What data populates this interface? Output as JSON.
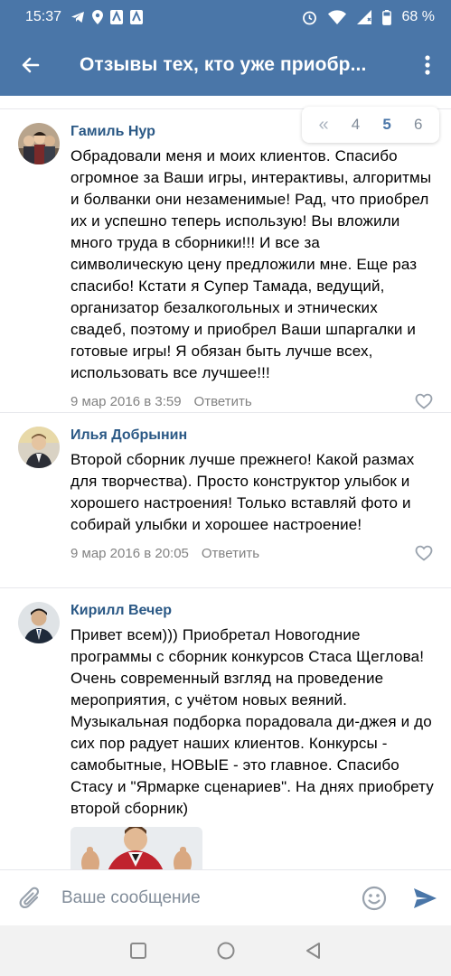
{
  "status_bar": {
    "time": "15:37",
    "battery": "68 %"
  },
  "header": {
    "title": "Отзывы тех, кто уже приобр..."
  },
  "pagination": {
    "first": "«",
    "pages": [
      "4",
      "5",
      "6"
    ],
    "active_page": "5"
  },
  "comments": [
    {
      "author": "Гамиль Нур",
      "text": "Обрадовали меня и моих клиентов. Спасибо огромное за Ваши игры, интерактивы, алгоритмы и болванки они незаменимые! Рад, что приобрел их и успешно теперь использую! Вы вложили много труда в сборники!!! И все за символическую цену предложили мне. Еще раз спасибо! Кстати я Супер Тамада, ведущий, организатор безалкогольных и этнических свадеб, поэтому и приобрел Ваши шпаргалки и готовые игры! Я обязан быть лучше всех, использовать все лучшее!!!",
      "date": "9 мар 2016 в 3:59",
      "reply": "Ответить"
    },
    {
      "author": "Илья Добрынин",
      "text": "Второй сборник лучше прежнего! Какой размах для творчества). Просто конструктор улыбок и хорошего настроения! Только вставляй фото и собирай улыбки и хорошее настроение!",
      "date": "9 мар 2016 в 20:05",
      "reply": "Ответить"
    },
    {
      "author": "Кирилл Вечер",
      "text": "Привет всем))) Приобретал Новогодние программы с сборник конкурсов Стаса Щеглова! Очень современный взгляд на проведение мероприятия, с учётом новых веяний. Музыкальная подборка порадовала ди-джея и до сих пор радует наших клиентов. Конкурсы - самобытные, НОВЫЕ - это главное. Спасибо Стасу и \"Ярмарке сценариев\". На днях приобрету второй сборник)"
    }
  ],
  "input": {
    "placeholder": "Ваше сообщение"
  },
  "colors": {
    "header": "#4a76a8",
    "author": "#2a5885",
    "meta": "#828282",
    "send": "#4a76a8"
  },
  "icons": {
    "back": "arrow-left",
    "more": "vertical-dots",
    "like": "heart-outline",
    "attach": "paperclip",
    "emoji": "smile",
    "send": "paper-plane"
  }
}
